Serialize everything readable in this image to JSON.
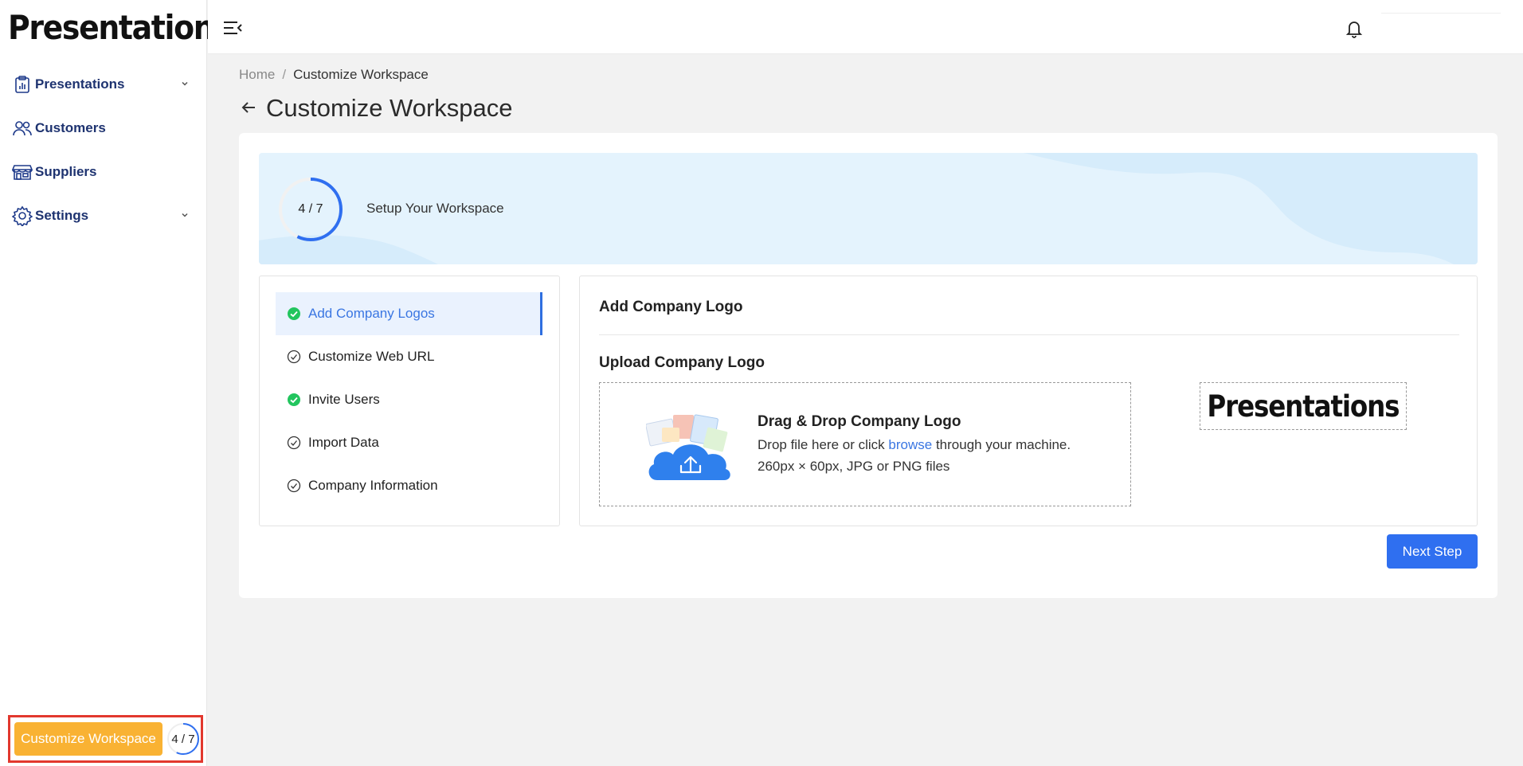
{
  "app": {
    "logo_text": "Presentations"
  },
  "sidebar": {
    "items": [
      {
        "label": "Presentations",
        "icon": "clipboard-chart-icon",
        "has_dropdown": true
      },
      {
        "label": "Customers",
        "icon": "users-icon",
        "has_dropdown": false
      },
      {
        "label": "Suppliers",
        "icon": "store-icon",
        "has_dropdown": false
      },
      {
        "label": "Settings",
        "icon": "gear-icon",
        "has_dropdown": true
      }
    ],
    "customize_button": "Customize Workspace",
    "customize_progress": "4 / 7",
    "customize_progress_fraction": 0.571
  },
  "header": {
    "menu_icon": "menu-collapse-icon",
    "notification_icon": "bell-icon"
  },
  "breadcrumb": {
    "home": "Home",
    "separator": "/",
    "current": "Customize Workspace"
  },
  "page": {
    "title": "Customize Workspace"
  },
  "banner": {
    "progress": "4 / 7",
    "progress_fraction": 0.571,
    "text": "Setup Your Workspace"
  },
  "steps": [
    {
      "label": "Add Company Logos",
      "status": "completed",
      "active": true
    },
    {
      "label": "Customize Web URL",
      "status": "pending",
      "active": false
    },
    {
      "label": "Invite Users",
      "status": "completed",
      "active": false
    },
    {
      "label": "Import Data",
      "status": "pending",
      "active": false
    },
    {
      "label": "Company Information",
      "status": "pending",
      "active": false
    }
  ],
  "panel": {
    "title": "Add Company Logo",
    "upload_label": "Upload Company Logo",
    "dropzone": {
      "title": "Drag & Drop Company Logo",
      "line1_prefix": "Drop file here or click",
      "browse": "browse",
      "line1_suffix": "through your machine.",
      "line2": "260px × 60px, JPG or PNG files"
    },
    "preview_logo_text": "Presentations"
  },
  "actions": {
    "next": "Next Step"
  },
  "colors": {
    "accent": "#2f6ff0",
    "success": "#22c55e",
    "warning": "#f9b233",
    "banner_bg": "#e4f3fd"
  }
}
